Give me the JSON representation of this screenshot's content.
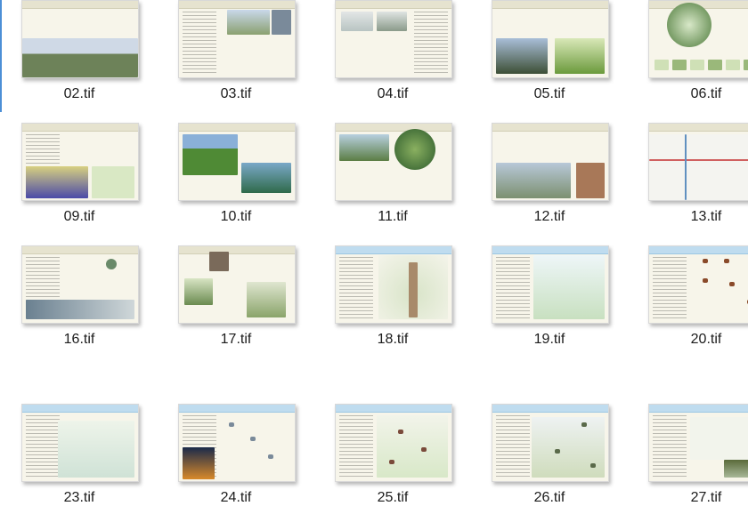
{
  "files": [
    {
      "name": "02.tif",
      "variant": "landscape"
    },
    {
      "name": "03.tif",
      "variant": "people"
    },
    {
      "name": "04.tif",
      "variant": "water"
    },
    {
      "name": "05.tif",
      "variant": "forest"
    },
    {
      "name": "06.tif",
      "variant": "globe"
    },
    {
      "name": "09.tif",
      "variant": "flowers"
    },
    {
      "name": "10.tif",
      "variant": "garden"
    },
    {
      "name": "11.tif",
      "variant": "globe-green"
    },
    {
      "name": "12.tif",
      "variant": "abbey"
    },
    {
      "name": "13.tif",
      "variant": "map"
    },
    {
      "name": "16.tif",
      "variant": "logos"
    },
    {
      "name": "17.tif",
      "variant": "portrait"
    },
    {
      "name": "18.tif",
      "variant": "tree"
    },
    {
      "name": "19.tif",
      "variant": "birds"
    },
    {
      "name": "20.tif",
      "variant": "raptors"
    },
    {
      "name": "23.tif",
      "variant": "pond"
    },
    {
      "name": "24.tif",
      "variant": "kingfisher"
    },
    {
      "name": "25.tif",
      "variant": "swallow"
    },
    {
      "name": "26.tif",
      "variant": "wetland"
    },
    {
      "name": "27.tif",
      "variant": "ducks"
    }
  ]
}
